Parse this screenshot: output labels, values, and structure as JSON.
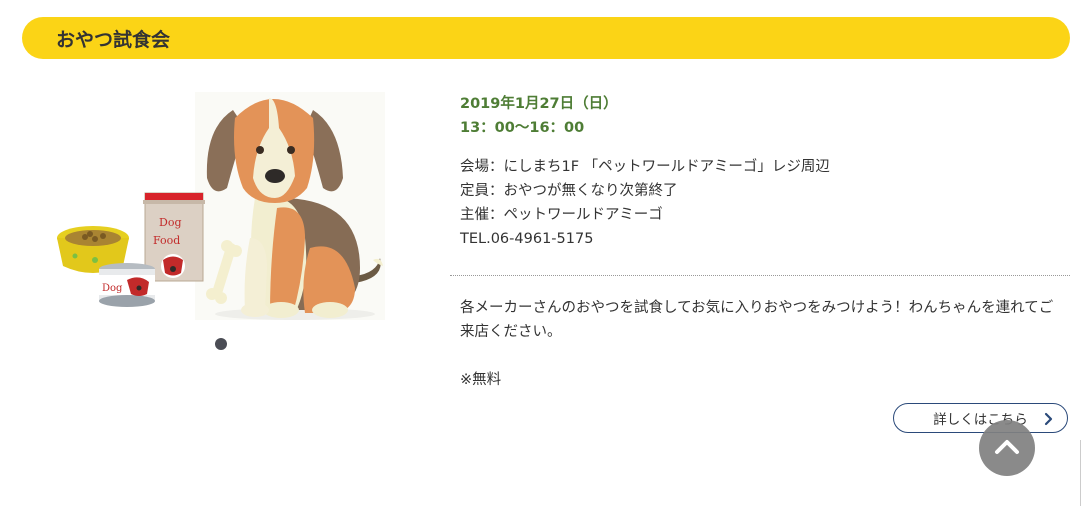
{
  "section": {
    "title": "おやつ試食会"
  },
  "event": {
    "date": "2019年1月27日（日）",
    "time": "13：00〜16：00",
    "details": [
      "会場：にしまち1F 「ペットワールドアミーゴ」レジ周辺",
      "定員：おやつが無くなり次第終了",
      "主催：ペットワールドアミーゴ",
      "TEL.06-4961-5175"
    ],
    "description": "各メーカーさんのおやつを試食してお気に入りおやつをみつけよう！わんちゃんを連れてご来店ください。",
    "note": "※無料"
  },
  "illustration": {
    "bag_text_line1": "Dog",
    "bag_text_line2": "Food",
    "can_text": "Dog"
  },
  "more_button": {
    "label": "詳しくはこちら"
  },
  "colors": {
    "title_bar": "#fbd416",
    "date_text": "#4e7d35",
    "button_border": "#2b4a7a"
  },
  "icons": {
    "more": "chevron-right-icon",
    "back_to_top": "chevron-up-icon"
  }
}
